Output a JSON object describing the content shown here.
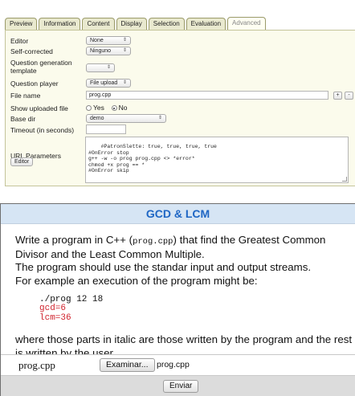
{
  "tabs": [
    "Preview",
    "Information",
    "Content",
    "Display",
    "Selection",
    "Evaluation",
    "Advanced"
  ],
  "form": {
    "editor": {
      "label": "Editor",
      "value": "None"
    },
    "self_corrected": {
      "label": "Self-corrected",
      "value": "Ninguno"
    },
    "question_generation_template": {
      "label": "Question generation template",
      "value": ""
    },
    "question_player": {
      "label": "Question player",
      "value": "File upload"
    },
    "file_name": {
      "label": "File name",
      "value": "prog.cpp",
      "add_button": "+",
      "remove_button": "-"
    },
    "show_uploaded_file": {
      "label": "Show uploaded file",
      "yes": "Yes",
      "no": "No",
      "selected": "No"
    },
    "base_dir": {
      "label": "Base dir",
      "value": "demo"
    },
    "timeout": {
      "label": "Timeout (in seconds)",
      "value": ""
    },
    "url_parameters": {
      "label": "URL Parameters",
      "editor_button": "Editor",
      "content": "#PatronSlette: true, true, true, true\n#OnError stop\ng++ -w -o prog prog.cpp <> *error*\nchmod +x prog == *\n#OnError skip"
    }
  },
  "question": {
    "title": "GCD & LCM",
    "intro_before": "Write a program in C++ (",
    "intro_file": "prog.cpp",
    "intro_after": ") that find the Greatest Common Divisor and the Least Common Multiple.",
    "line2": "The program should use the standar input and output streams.",
    "line3": "For example an execution of the program might be:",
    "code": {
      "command": "./prog 12 18",
      "out1": "gcd=6",
      "out2": "lcm=36"
    },
    "outro": "where those parts in italic are those written by the program and the rest is written by the user.",
    "file_label": "prog.cpp",
    "browse_button": "Examinar...",
    "chosen_file": "prog.cpp",
    "submit_button": "Enviar"
  },
  "colors": {
    "header_bg": "#d6e5f4",
    "title_color": "#1e66c4",
    "output_color": "#d0232d",
    "form_bg": "#fbfbec"
  }
}
